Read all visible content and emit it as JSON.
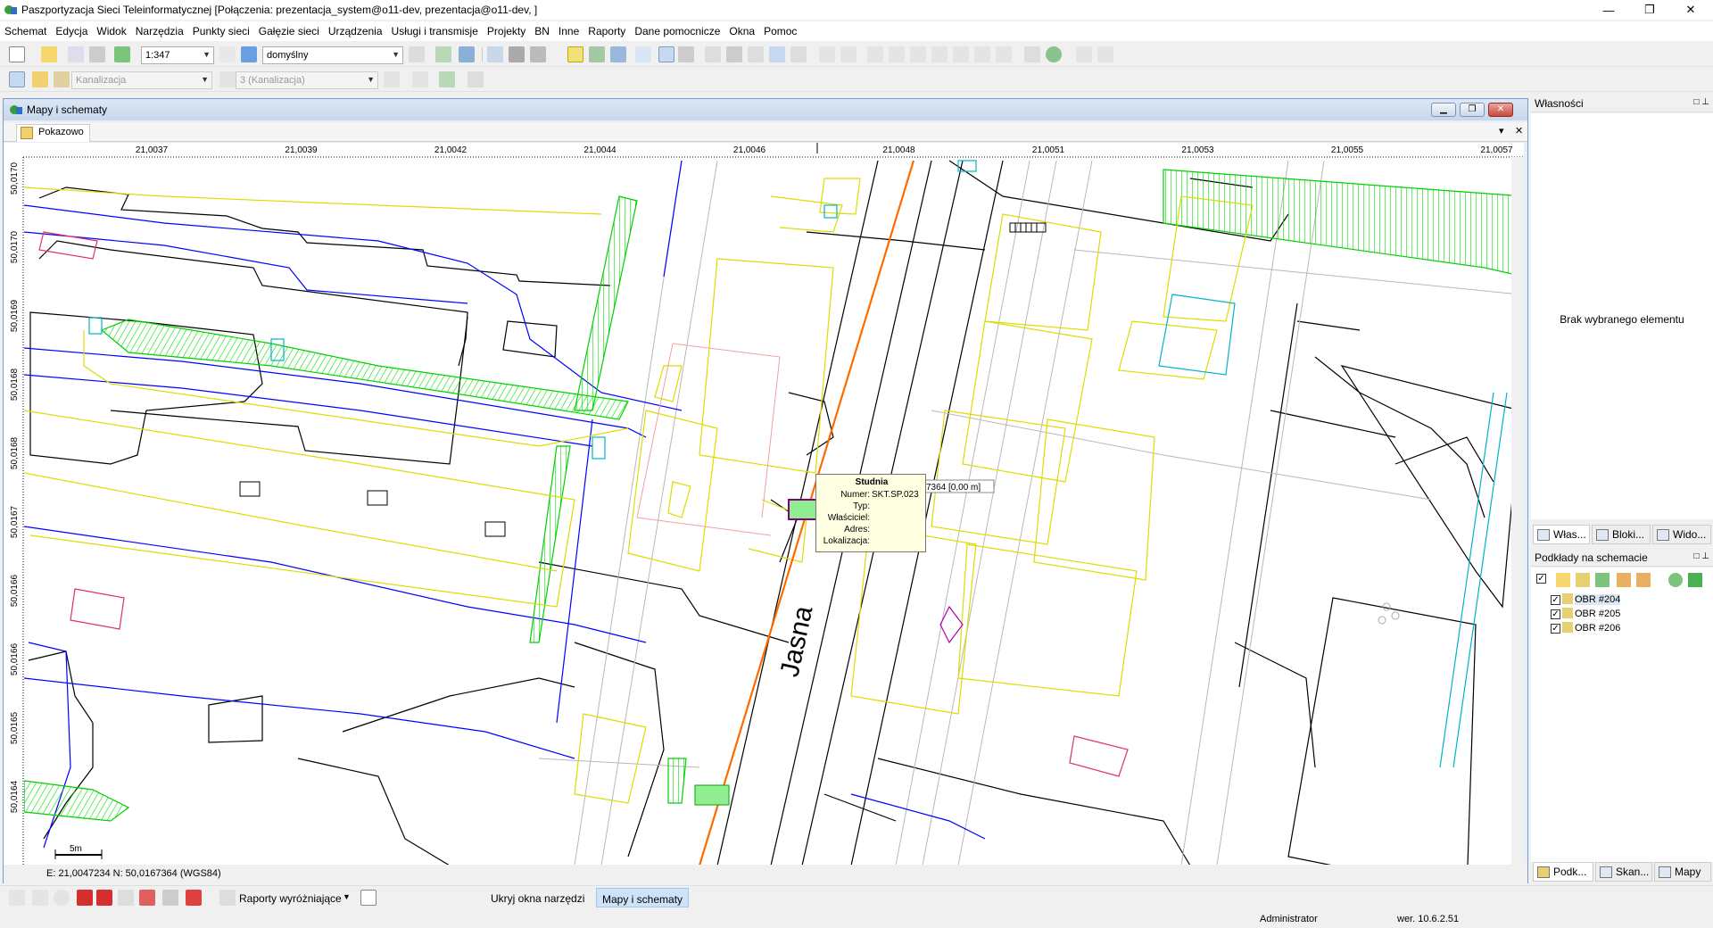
{
  "window": {
    "title": "Paszportyzacja Sieci Teleinformatycznej [Połączenia: prezentacja_system@o11-dev, prezentacja@o11-dev, ]",
    "minimize": "—",
    "maximize": "❐",
    "close": "✕"
  },
  "menu": [
    "Schemat",
    "Edycja",
    "Widok",
    "Narzędzia",
    "Punkty sieci",
    "Gałęzie sieci",
    "Urządzenia",
    "Usługi i transmisje",
    "Projekty",
    "BN",
    "Inne",
    "Raporty",
    "Dane pomocnicze",
    "Okna",
    "Pomoc"
  ],
  "toolbar1": {
    "scale_value": "1:347",
    "style_value": "domyślny"
  },
  "toolbar2": {
    "layer_value": "Kanalizacja",
    "sublayer_value": "3 (Kanalizacja)"
  },
  "mdi": {
    "title": "Mapy i schematy",
    "tab": "Pokazowo",
    "tab_dropdown": "▾",
    "tab_close": "✕",
    "coords": "E: 21,0047234  N: 50,0167364 (WGS84)"
  },
  "map": {
    "x_ticks": [
      "21,0037",
      "21,0039",
      "21,0042",
      "21,0044",
      "21,0046",
      "21,0048",
      "21,0051",
      "21,0053",
      "21,0055",
      "21,0057"
    ],
    "y_ticks": [
      "50,0170",
      "50,0170",
      "50,0169",
      "50,0168",
      "50,0168",
      "50,0167",
      "50,0166",
      "50,0166",
      "50,0165",
      "50,0164"
    ],
    "street_label": "Jasna",
    "scale_label": "5m",
    "measure_label": "7364  [0,00 m]"
  },
  "tooltip": {
    "title": "Studnia",
    "rows": [
      {
        "label": "Numer:",
        "value": "SKT.SP.023"
      },
      {
        "label": "Typ:",
        "value": ""
      },
      {
        "label": "Właściciel:",
        "value": ""
      },
      {
        "label": "Adres:",
        "value": ""
      },
      {
        "label": "Lokalizacja:",
        "value": ""
      }
    ]
  },
  "properties_panel": {
    "title": "Własności",
    "empty_text": "Brak wybranego elementu",
    "tabs": [
      "Włas...",
      "Bloki...",
      "Wido..."
    ]
  },
  "layers_panel": {
    "title": "Podkłady na schemacie",
    "items": [
      "OBR #204",
      "OBR #205",
      "OBR #206"
    ],
    "tabs": [
      "Podk...",
      "Skan...",
      "Mapy"
    ]
  },
  "bottom_toolbar": {
    "reports_label": "Raporty wyróżniające",
    "hide_tools": "Ukryj okna narzędzi",
    "active_window": "Mapy i schematy"
  },
  "status": {
    "user": "Administrator",
    "version": "wer. 10.6.2.51"
  },
  "colors": {
    "accent": "#316ac5",
    "tooltip_bg": "#ffffe1",
    "map_green": "#00e000",
    "map_blue": "#0000ff",
    "map_yellow": "#e6e600",
    "map_orange": "#ff6a00"
  }
}
